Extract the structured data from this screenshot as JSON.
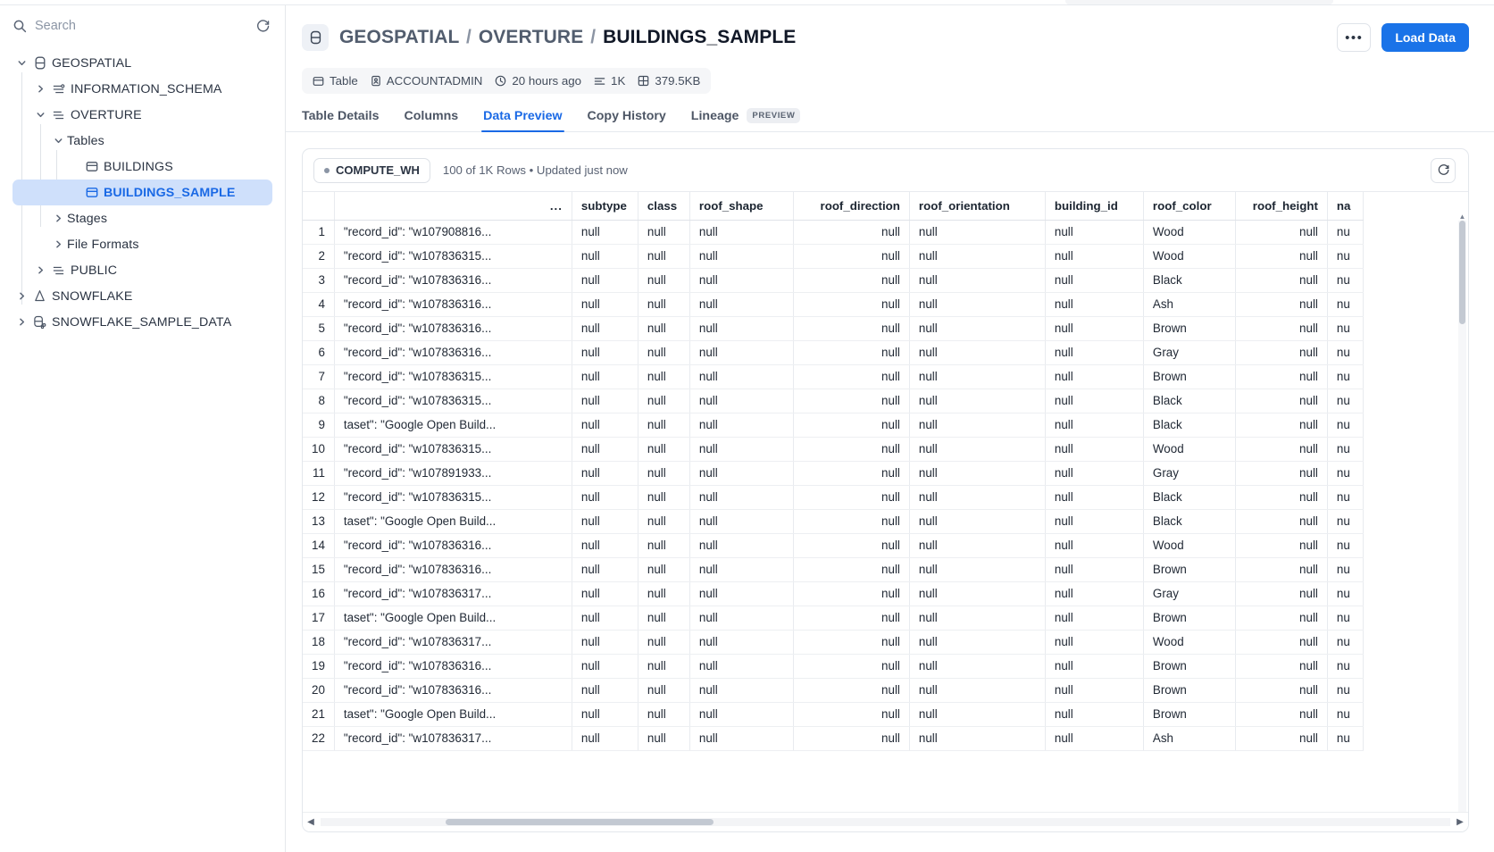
{
  "sidebar": {
    "search_placeholder": "Search",
    "search_value": "",
    "refresh_icon": "refresh-icon",
    "items": [
      {
        "label": "GEOSPATIAL",
        "level": 1,
        "icon": "database-icon",
        "expanded": true,
        "selected": false
      },
      {
        "label": "INFORMATION_SCHEMA",
        "level": 2,
        "icon": "schema-icon",
        "expanded": false,
        "selected": false
      },
      {
        "label": "OVERTURE",
        "level": 2,
        "icon": "schema-icon",
        "expanded": true,
        "selected": false
      },
      {
        "label": "Tables",
        "level": 3,
        "icon": "none",
        "expanded": true,
        "selected": false
      },
      {
        "label": "BUILDINGS",
        "level": 4,
        "icon": "table-icon",
        "expanded": null,
        "selected": false
      },
      {
        "label": "BUILDINGS_SAMPLE",
        "level": 4,
        "icon": "table-icon",
        "expanded": null,
        "selected": true
      },
      {
        "label": "Stages",
        "level": 3,
        "icon": "none",
        "expanded": false,
        "selected": false
      },
      {
        "label": "File Formats",
        "level": 3,
        "icon": "none",
        "expanded": false,
        "selected": false
      },
      {
        "label": "PUBLIC",
        "level": 2,
        "icon": "schema-icon",
        "expanded": false,
        "selected": false
      },
      {
        "label": "SNOWFLAKE",
        "level": 1,
        "icon": "snowflake-icon",
        "expanded": false,
        "selected": false
      },
      {
        "label": "SNOWFLAKE_SAMPLE_DATA",
        "level": 1,
        "icon": "shared-db-icon",
        "expanded": false,
        "selected": false
      }
    ]
  },
  "header": {
    "object_icon": "table-icon",
    "breadcrumb": {
      "database": "GEOSPATIAL",
      "schema": "OVERTURE",
      "table": "BUILDINGS_SAMPLE",
      "separator": "/"
    },
    "more_label": "•••",
    "load_data_label": "Load Data",
    "chips": [
      {
        "icon": "table-icon",
        "label": "Table"
      },
      {
        "icon": "owner-icon",
        "label": "ACCOUNTADMIN"
      },
      {
        "icon": "clock-icon",
        "label": "20 hours ago"
      },
      {
        "icon": "rows-icon",
        "label": "1K"
      },
      {
        "icon": "size-icon",
        "label": "379.5KB"
      }
    ]
  },
  "tabs": [
    {
      "label": "Table Details",
      "active": false,
      "badge": ""
    },
    {
      "label": "Columns",
      "active": false,
      "badge": ""
    },
    {
      "label": "Data Preview",
      "active": true,
      "badge": ""
    },
    {
      "label": "Copy History",
      "active": false,
      "badge": ""
    },
    {
      "label": "Lineage",
      "active": false,
      "badge": "PREVIEW"
    }
  ],
  "toolbar": {
    "warehouse": "COMPUTE_WH",
    "row_info": "100 of 1K Rows • Updated just now",
    "refresh_icon": "refresh-icon"
  },
  "table": {
    "columns": [
      {
        "name": "",
        "key": "idx",
        "align": "right"
      },
      {
        "name": "...",
        "key": "json",
        "align": "right"
      },
      {
        "name": "subtype",
        "key": "subtype",
        "align": "left"
      },
      {
        "name": "class",
        "key": "class",
        "align": "left"
      },
      {
        "name": "roof_shape",
        "key": "roof_shape",
        "align": "left"
      },
      {
        "name": "roof_direction",
        "key": "roof_direction",
        "align": "right"
      },
      {
        "name": "roof_orientation",
        "key": "roof_orientation",
        "align": "left"
      },
      {
        "name": "building_id",
        "key": "building_id",
        "align": "left"
      },
      {
        "name": "roof_color",
        "key": "roof_color",
        "align": "left"
      },
      {
        "name": "roof_height",
        "key": "roof_height",
        "align": "right"
      },
      {
        "name": "na",
        "key": "na",
        "align": "left"
      }
    ],
    "null_text": "null",
    "rows": [
      {
        "idx": "1",
        "json": "\"record_id\": \"w107908816...",
        "subtype": "null",
        "class": "null",
        "roof_shape": "null",
        "roof_direction": "null",
        "roof_orientation": "null",
        "building_id": "null",
        "roof_color": "Wood",
        "roof_height": "null",
        "na": "nu"
      },
      {
        "idx": "2",
        "json": "\"record_id\": \"w107836315...",
        "subtype": "null",
        "class": "null",
        "roof_shape": "null",
        "roof_direction": "null",
        "roof_orientation": "null",
        "building_id": "null",
        "roof_color": "Wood",
        "roof_height": "null",
        "na": "nu"
      },
      {
        "idx": "3",
        "json": "\"record_id\": \"w107836316...",
        "subtype": "null",
        "class": "null",
        "roof_shape": "null",
        "roof_direction": "null",
        "roof_orientation": "null",
        "building_id": "null",
        "roof_color": "Black",
        "roof_height": "null",
        "na": "nu"
      },
      {
        "idx": "4",
        "json": "\"record_id\": \"w107836316...",
        "subtype": "null",
        "class": "null",
        "roof_shape": "null",
        "roof_direction": "null",
        "roof_orientation": "null",
        "building_id": "null",
        "roof_color": "Ash",
        "roof_height": "null",
        "na": "nu"
      },
      {
        "idx": "5",
        "json": "\"record_id\": \"w107836316...",
        "subtype": "null",
        "class": "null",
        "roof_shape": "null",
        "roof_direction": "null",
        "roof_orientation": "null",
        "building_id": "null",
        "roof_color": "Brown",
        "roof_height": "null",
        "na": "nu"
      },
      {
        "idx": "6",
        "json": "\"record_id\": \"w107836316...",
        "subtype": "null",
        "class": "null",
        "roof_shape": "null",
        "roof_direction": "null",
        "roof_orientation": "null",
        "building_id": "null",
        "roof_color": "Gray",
        "roof_height": "null",
        "na": "nu"
      },
      {
        "idx": "7",
        "json": "\"record_id\": \"w107836315...",
        "subtype": "null",
        "class": "null",
        "roof_shape": "null",
        "roof_direction": "null",
        "roof_orientation": "null",
        "building_id": "null",
        "roof_color": "Brown",
        "roof_height": "null",
        "na": "nu"
      },
      {
        "idx": "8",
        "json": "\"record_id\": \"w107836315...",
        "subtype": "null",
        "class": "null",
        "roof_shape": "null",
        "roof_direction": "null",
        "roof_orientation": "null",
        "building_id": "null",
        "roof_color": "Black",
        "roof_height": "null",
        "na": "nu"
      },
      {
        "idx": "9",
        "json": "taset\": \"Google Open Build...",
        "subtype": "null",
        "class": "null",
        "roof_shape": "null",
        "roof_direction": "null",
        "roof_orientation": "null",
        "building_id": "null",
        "roof_color": "Black",
        "roof_height": "null",
        "na": "nu"
      },
      {
        "idx": "10",
        "json": "\"record_id\": \"w107836315...",
        "subtype": "null",
        "class": "null",
        "roof_shape": "null",
        "roof_direction": "null",
        "roof_orientation": "null",
        "building_id": "null",
        "roof_color": "Wood",
        "roof_height": "null",
        "na": "nu"
      },
      {
        "idx": "11",
        "json": "\"record_id\": \"w107891933...",
        "subtype": "null",
        "class": "null",
        "roof_shape": "null",
        "roof_direction": "null",
        "roof_orientation": "null",
        "building_id": "null",
        "roof_color": "Gray",
        "roof_height": "null",
        "na": "nu"
      },
      {
        "idx": "12",
        "json": "\"record_id\": \"w107836315...",
        "subtype": "null",
        "class": "null",
        "roof_shape": "null",
        "roof_direction": "null",
        "roof_orientation": "null",
        "building_id": "null",
        "roof_color": "Black",
        "roof_height": "null",
        "na": "nu"
      },
      {
        "idx": "13",
        "json": "taset\": \"Google Open Build...",
        "subtype": "null",
        "class": "null",
        "roof_shape": "null",
        "roof_direction": "null",
        "roof_orientation": "null",
        "building_id": "null",
        "roof_color": "Black",
        "roof_height": "null",
        "na": "nu"
      },
      {
        "idx": "14",
        "json": "\"record_id\": \"w107836316...",
        "subtype": "null",
        "class": "null",
        "roof_shape": "null",
        "roof_direction": "null",
        "roof_orientation": "null",
        "building_id": "null",
        "roof_color": "Wood",
        "roof_height": "null",
        "na": "nu"
      },
      {
        "idx": "15",
        "json": "\"record_id\": \"w107836316...",
        "subtype": "null",
        "class": "null",
        "roof_shape": "null",
        "roof_direction": "null",
        "roof_orientation": "null",
        "building_id": "null",
        "roof_color": "Brown",
        "roof_height": "null",
        "na": "nu"
      },
      {
        "idx": "16",
        "json": "\"record_id\": \"w107836317...",
        "subtype": "null",
        "class": "null",
        "roof_shape": "null",
        "roof_direction": "null",
        "roof_orientation": "null",
        "building_id": "null",
        "roof_color": "Gray",
        "roof_height": "null",
        "na": "nu"
      },
      {
        "idx": "17",
        "json": "taset\": \"Google Open Build...",
        "subtype": "null",
        "class": "null",
        "roof_shape": "null",
        "roof_direction": "null",
        "roof_orientation": "null",
        "building_id": "null",
        "roof_color": "Brown",
        "roof_height": "null",
        "na": "nu"
      },
      {
        "idx": "18",
        "json": "\"record_id\": \"w107836317...",
        "subtype": "null",
        "class": "null",
        "roof_shape": "null",
        "roof_direction": "null",
        "roof_orientation": "null",
        "building_id": "null",
        "roof_color": "Wood",
        "roof_height": "null",
        "na": "nu"
      },
      {
        "idx": "19",
        "json": "\"record_id\": \"w107836316...",
        "subtype": "null",
        "class": "null",
        "roof_shape": "null",
        "roof_direction": "null",
        "roof_orientation": "null",
        "building_id": "null",
        "roof_color": "Brown",
        "roof_height": "null",
        "na": "nu"
      },
      {
        "idx": "20",
        "json": "\"record_id\": \"w107836316...",
        "subtype": "null",
        "class": "null",
        "roof_shape": "null",
        "roof_direction": "null",
        "roof_orientation": "null",
        "building_id": "null",
        "roof_color": "Brown",
        "roof_height": "null",
        "na": "nu"
      },
      {
        "idx": "21",
        "json": "taset\": \"Google Open Build...",
        "subtype": "null",
        "class": "null",
        "roof_shape": "null",
        "roof_direction": "null",
        "roof_orientation": "null",
        "building_id": "null",
        "roof_color": "Brown",
        "roof_height": "null",
        "na": "nu"
      },
      {
        "idx": "22",
        "json": "\"record_id\": \"w107836317...",
        "subtype": "null",
        "class": "null",
        "roof_shape": "null",
        "roof_direction": "null",
        "roof_orientation": "null",
        "building_id": "null",
        "roof_color": "Ash",
        "roof_height": "null",
        "na": "nu"
      }
    ]
  },
  "scrollbars": {
    "left_arrow": "◀",
    "right_arrow": "▶",
    "up_arrow": "▲",
    "down_arrow": "▼"
  },
  "colors": {
    "accent": "#1a73e8",
    "accent_text": "#1a69e5",
    "selected_bg": "#cfe0fb",
    "border": "#e3e7ec",
    "text": "#222a36"
  }
}
